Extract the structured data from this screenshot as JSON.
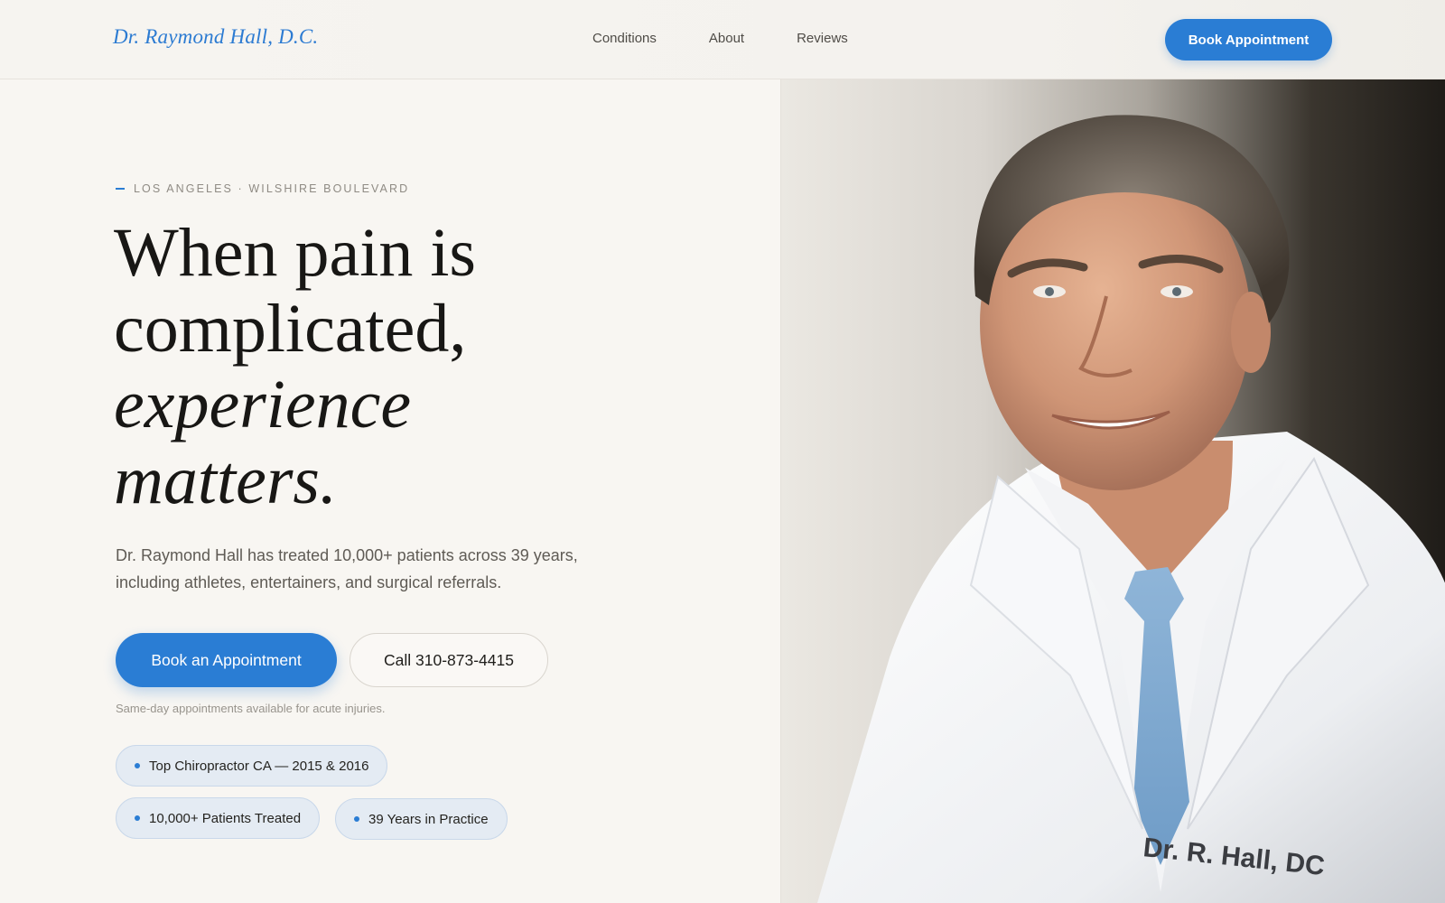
{
  "header": {
    "logo": "Dr. Raymond Hall, D.C.",
    "nav": [
      "Conditions",
      "About",
      "Reviews"
    ],
    "cta": "Book Appointment"
  },
  "hero": {
    "eyebrow": "LOS ANGELES · WILSHIRE BOULEVARD",
    "headline": {
      "line1": "When pain is",
      "line2": "complicated,",
      "line3": "experience",
      "line4": "matters."
    },
    "lead": "Dr. Raymond Hall has treated 10,000+ patients across 39 years, including athletes, entertainers, and surgical referrals.",
    "primary_button": "Book an Appointment",
    "secondary_button": "Call 310-873-4415",
    "note": "Same-day appointments available for acute injuries.",
    "badges": [
      "Top Chiropractor CA — 2015 & 2016",
      "10,000+ Patients Treated",
      "39 Years in Practice"
    ]
  },
  "portrait": {
    "coat_text": "Dr. R. Hall, DC"
  },
  "colors": {
    "accent": "#2a7dd4",
    "background": "#f8f6f2",
    "headline": "#181715"
  }
}
